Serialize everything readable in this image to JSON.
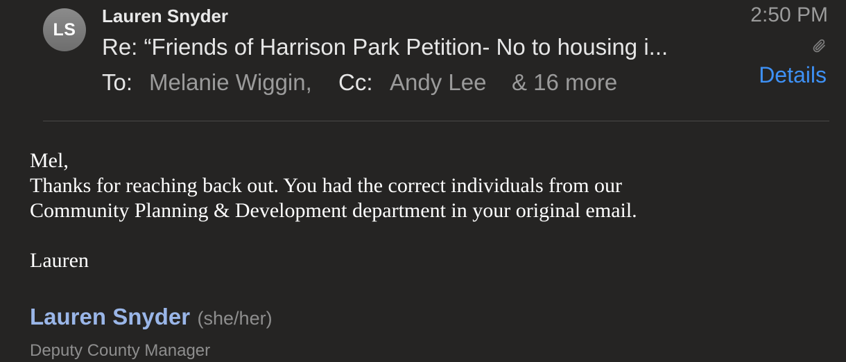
{
  "header": {
    "avatar_initials": "LS",
    "sender_name": "Lauren Snyder",
    "subject": "Re: “Friends of Harrison Park Petition- No to housing i...",
    "to_label": "To:",
    "to_recipient": "Melanie Wiggin,",
    "cc_label": "Cc:",
    "cc_recipient": "Andy Lee",
    "more_recipients": "& 16 more",
    "time": "2:50 PM",
    "details_label": "Details",
    "attachment_icon": "paperclip-icon"
  },
  "message": {
    "greeting": "Mel,",
    "line1": "Thanks for reaching back out. You had the correct individuals from our",
    "line2": "Community Planning & Development department in your original email.",
    "closing": "Lauren"
  },
  "signature": {
    "name": "Lauren Snyder",
    "pronouns": "(she/her)",
    "title": "Deputy County Manager"
  },
  "colors": {
    "background": "#252423",
    "link_blue": "#3e91f6",
    "signature_name": "#9ab6e8"
  }
}
